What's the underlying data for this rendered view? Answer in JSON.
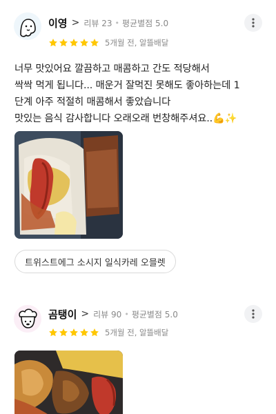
{
  "colors": {
    "star": "#ffc700",
    "meta": "#888888",
    "chip_border": "#d9d9d9"
  },
  "reviews": [
    {
      "nickname": "이영",
      "review_count_label": "리뷰 23",
      "avg_rating_label": "평균별점 5.0",
      "rating": 5,
      "time_order_label": "5개월 전, 알뜰배달",
      "text_lines": [
        "너무 맛있어요 깔끔하고 매콤하고 간도 적당해서",
        "싹싹 먹게 됩니다... 매운거 잘먹진 못해도 좋아하는데 1",
        "단계 아주 적절히 매콤해서 좋았습니다",
        "맛있는 음식 감사합니다 오래오래 번창해주셔요..💪✨"
      ],
      "menu_chip": "트위스트에그 소시지 일식카레 오믈렛",
      "avatar_icon": "ghost-face-icon",
      "photo_desc": "food-photo"
    },
    {
      "nickname": "곰탱이",
      "review_count_label": "리뷰 90",
      "avg_rating_label": "평균별점 5.0",
      "rating": 5,
      "time_order_label": "5개월 전, 알뜰배달",
      "avatar_icon": "chef-hat-face-icon",
      "photo_desc": "food-photo"
    }
  ]
}
